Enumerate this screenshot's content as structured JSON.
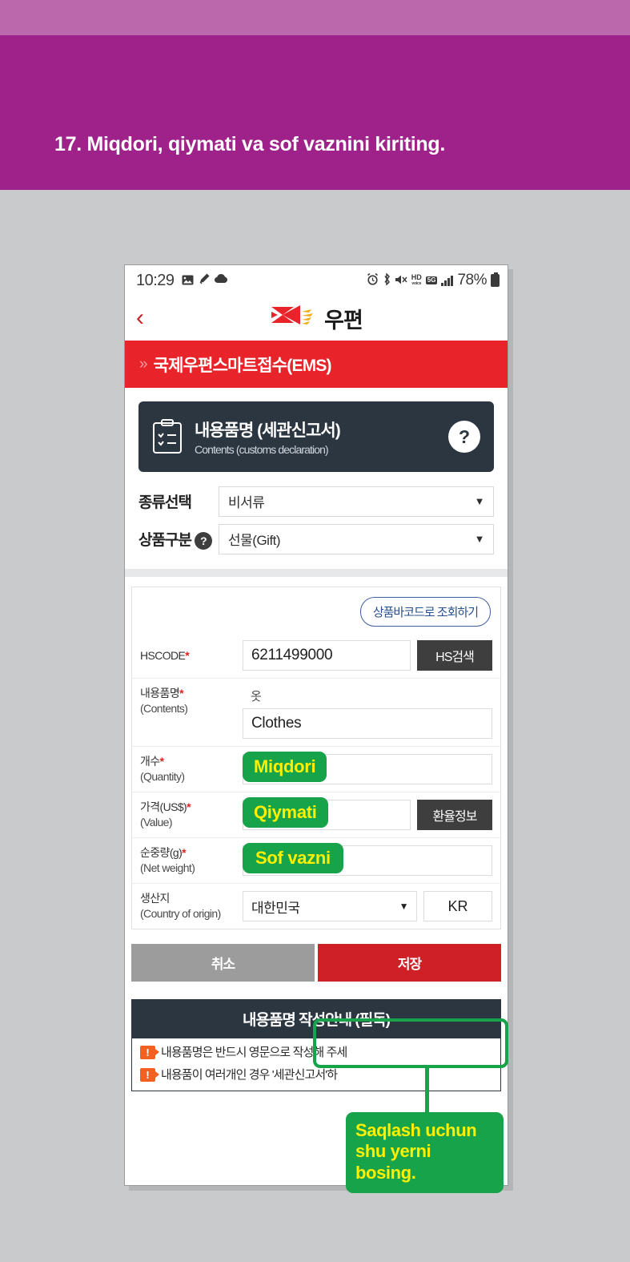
{
  "banner": {
    "title": "17. Miqdori, qiymati va sof vaznini kiriting.",
    "color_light": "#bb68ad",
    "color_dark": "#9e2289"
  },
  "phone": {
    "statusbar": {
      "time": "10:29",
      "left_icons": [
        "image-icon",
        "pen-icon",
        "cloud-icon"
      ],
      "right_icons": [
        "alarm-icon",
        "bluetooth-icon",
        "mute-icon",
        "hd-voice-icon",
        "5g-icon",
        "signal-bars-icon",
        "battery-icon"
      ],
      "hd_label": "HD",
      "hd_sub": "voice",
      "fiveg_label": "5G",
      "battery_percent": "78%"
    },
    "appbar": {
      "back_icon": "back-chevron-icon",
      "logo_text": "우편"
    },
    "redbar": {
      "chevrons": "»",
      "title": "국제우편스마트접수(EMS)"
    },
    "section": {
      "icon": "clipboard-checklist-icon",
      "title": "내용품명 (세관신고서)",
      "subtitle": "Contents (customs declaration)",
      "help": "?"
    },
    "selects": [
      {
        "label": "종류선택",
        "has_help": false,
        "value": "비서류",
        "caret": "▼"
      },
      {
        "label": "상품구분",
        "has_help": true,
        "help": "?",
        "value": "선물(Gift)",
        "caret": "▼"
      }
    ],
    "form": {
      "barcode_button": "상품바코드로 조회하기",
      "rows": {
        "hscode": {
          "label": "HSCODE",
          "required": "*",
          "value": "6211499000",
          "button": "HS검색"
        },
        "contents": {
          "label": "내용품명",
          "required": "*",
          "sub": "(Contents)",
          "ko_value": "옷",
          "en_value": "Clothes"
        },
        "quantity": {
          "label": "개수",
          "required": "*",
          "sub": "(Quantity)",
          "value": "",
          "badge": "Miqdori"
        },
        "value": {
          "label": "가격(US$)",
          "required": "*",
          "sub": "(Value)",
          "value": "",
          "badge": "Qiymati",
          "button": "환율정보"
        },
        "net_weight": {
          "label": "순중량(g)",
          "required": "*",
          "sub": "(Net weight)",
          "value": "",
          "badge": "Sof vazni"
        },
        "origin": {
          "label": "생산지",
          "sub": "(Country of origin)",
          "value": "대한민국",
          "caret": "▼",
          "code": "KR"
        }
      }
    },
    "actions": {
      "cancel": "취소",
      "save": "저장"
    },
    "guide": {
      "heading": "내용품명 작성안내 (필독)",
      "lines": [
        "내용품명은 반드시 영문으로 작성해 주세",
        "내용품이 여러개인 경우 '세관신고서'하"
      ]
    }
  },
  "annotation": {
    "callout_text": "Saqlash uchun shu yerni bosing.",
    "highlight_color": "#17a34a",
    "callout_bg": "#17a34a",
    "callout_fg": "#ffef00"
  }
}
